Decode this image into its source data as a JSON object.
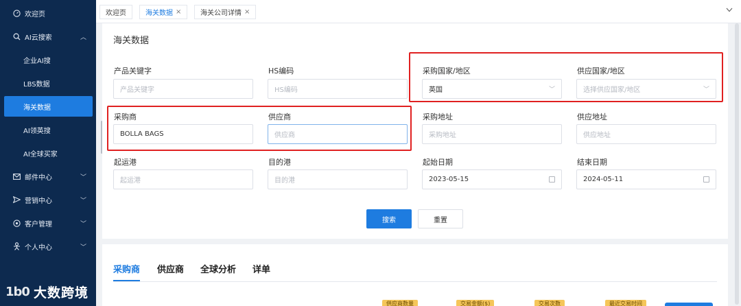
{
  "sidebar": {
    "items": [
      {
        "label": "欢迎页",
        "icon": "dashboard-icon"
      },
      {
        "label": "AI云搜索",
        "icon": "search-icon",
        "expanded": true
      },
      {
        "label": "企业AI搜"
      },
      {
        "label": "LBS数据"
      },
      {
        "label": "海关数据",
        "active": true
      },
      {
        "label": "AI领英搜"
      },
      {
        "label": "AI全球买家"
      },
      {
        "label": "邮件中心",
        "icon": "mail-icon"
      },
      {
        "label": "营销中心",
        "icon": "send-icon"
      },
      {
        "label": "客户管理",
        "icon": "settings-icon"
      },
      {
        "label": "个人中心",
        "icon": "person-icon"
      }
    ],
    "brand": {
      "mark": "1b0",
      "text": "大数跨境"
    }
  },
  "tabs": [
    {
      "label": "欢迎页",
      "closable": false
    },
    {
      "label": "海关数据",
      "closable": true,
      "active": true
    },
    {
      "label": "海关公司详情",
      "closable": true
    }
  ],
  "page": {
    "title": "海关数据"
  },
  "form": {
    "product_keyword": {
      "label": "产品关键字",
      "placeholder": "产品关键字"
    },
    "hs_code": {
      "label": "HS编码",
      "placeholder": "HS编码"
    },
    "buyer_country": {
      "label": "采购国家/地区",
      "value": "英国"
    },
    "supplier_country": {
      "label": "供应国家/地区",
      "placeholder": "选择供应国家/地区"
    },
    "buyer": {
      "label": "采购商",
      "value": "BOLLA BAGS"
    },
    "supplier": {
      "label": "供应商",
      "placeholder": "供应商"
    },
    "buyer_address": {
      "label": "采购地址",
      "placeholder": "采购地址"
    },
    "supplier_address": {
      "label": "供应地址",
      "placeholder": "供应地址"
    },
    "origin_port": {
      "label": "起运港",
      "placeholder": "起运港"
    },
    "dest_port": {
      "label": "目的港",
      "placeholder": "目的港"
    },
    "start_date": {
      "label": "起始日期",
      "value": "2023-05-15"
    },
    "end_date": {
      "label": "结束日期",
      "value": "2024-05-11"
    },
    "search_button": "搜索",
    "reset_button": "重置"
  },
  "result_tabs": [
    "采购商",
    "供应商",
    "全球分析",
    "详单"
  ],
  "result_chips": [
    "供应商数量",
    "交易金额($)",
    "交易次数",
    "最近交易时间"
  ],
  "colors": {
    "accent": "#1e7ce0",
    "sidebar": "#0d2a4f",
    "highlight": "#e02020"
  }
}
